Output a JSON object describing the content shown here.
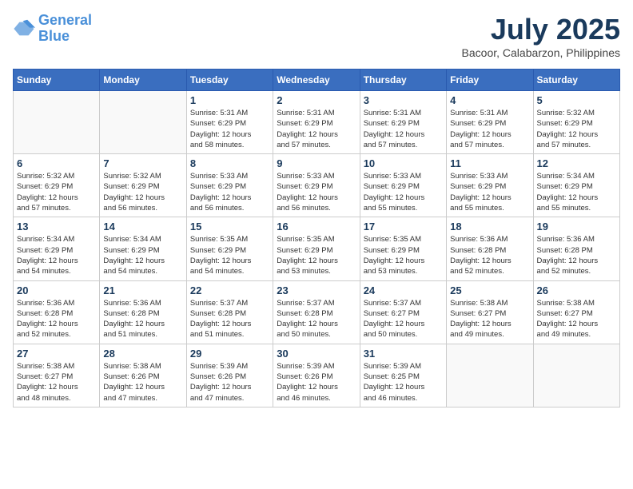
{
  "logo": {
    "line1": "General",
    "line2": "Blue"
  },
  "title": "July 2025",
  "location": "Bacoor, Calabarzon, Philippines",
  "weekdays": [
    "Sunday",
    "Monday",
    "Tuesday",
    "Wednesday",
    "Thursday",
    "Friday",
    "Saturday"
  ],
  "weeks": [
    [
      {
        "day": "",
        "info": ""
      },
      {
        "day": "",
        "info": ""
      },
      {
        "day": "1",
        "info": "Sunrise: 5:31 AM\nSunset: 6:29 PM\nDaylight: 12 hours\nand 58 minutes."
      },
      {
        "day": "2",
        "info": "Sunrise: 5:31 AM\nSunset: 6:29 PM\nDaylight: 12 hours\nand 57 minutes."
      },
      {
        "day": "3",
        "info": "Sunrise: 5:31 AM\nSunset: 6:29 PM\nDaylight: 12 hours\nand 57 minutes."
      },
      {
        "day": "4",
        "info": "Sunrise: 5:31 AM\nSunset: 6:29 PM\nDaylight: 12 hours\nand 57 minutes."
      },
      {
        "day": "5",
        "info": "Sunrise: 5:32 AM\nSunset: 6:29 PM\nDaylight: 12 hours\nand 57 minutes."
      }
    ],
    [
      {
        "day": "6",
        "info": "Sunrise: 5:32 AM\nSunset: 6:29 PM\nDaylight: 12 hours\nand 57 minutes."
      },
      {
        "day": "7",
        "info": "Sunrise: 5:32 AM\nSunset: 6:29 PM\nDaylight: 12 hours\nand 56 minutes."
      },
      {
        "day": "8",
        "info": "Sunrise: 5:33 AM\nSunset: 6:29 PM\nDaylight: 12 hours\nand 56 minutes."
      },
      {
        "day": "9",
        "info": "Sunrise: 5:33 AM\nSunset: 6:29 PM\nDaylight: 12 hours\nand 56 minutes."
      },
      {
        "day": "10",
        "info": "Sunrise: 5:33 AM\nSunset: 6:29 PM\nDaylight: 12 hours\nand 55 minutes."
      },
      {
        "day": "11",
        "info": "Sunrise: 5:33 AM\nSunset: 6:29 PM\nDaylight: 12 hours\nand 55 minutes."
      },
      {
        "day": "12",
        "info": "Sunrise: 5:34 AM\nSunset: 6:29 PM\nDaylight: 12 hours\nand 55 minutes."
      }
    ],
    [
      {
        "day": "13",
        "info": "Sunrise: 5:34 AM\nSunset: 6:29 PM\nDaylight: 12 hours\nand 54 minutes."
      },
      {
        "day": "14",
        "info": "Sunrise: 5:34 AM\nSunset: 6:29 PM\nDaylight: 12 hours\nand 54 minutes."
      },
      {
        "day": "15",
        "info": "Sunrise: 5:35 AM\nSunset: 6:29 PM\nDaylight: 12 hours\nand 54 minutes."
      },
      {
        "day": "16",
        "info": "Sunrise: 5:35 AM\nSunset: 6:29 PM\nDaylight: 12 hours\nand 53 minutes."
      },
      {
        "day": "17",
        "info": "Sunrise: 5:35 AM\nSunset: 6:29 PM\nDaylight: 12 hours\nand 53 minutes."
      },
      {
        "day": "18",
        "info": "Sunrise: 5:36 AM\nSunset: 6:28 PM\nDaylight: 12 hours\nand 52 minutes."
      },
      {
        "day": "19",
        "info": "Sunrise: 5:36 AM\nSunset: 6:28 PM\nDaylight: 12 hours\nand 52 minutes."
      }
    ],
    [
      {
        "day": "20",
        "info": "Sunrise: 5:36 AM\nSunset: 6:28 PM\nDaylight: 12 hours\nand 52 minutes."
      },
      {
        "day": "21",
        "info": "Sunrise: 5:36 AM\nSunset: 6:28 PM\nDaylight: 12 hours\nand 51 minutes."
      },
      {
        "day": "22",
        "info": "Sunrise: 5:37 AM\nSunset: 6:28 PM\nDaylight: 12 hours\nand 51 minutes."
      },
      {
        "day": "23",
        "info": "Sunrise: 5:37 AM\nSunset: 6:28 PM\nDaylight: 12 hours\nand 50 minutes."
      },
      {
        "day": "24",
        "info": "Sunrise: 5:37 AM\nSunset: 6:27 PM\nDaylight: 12 hours\nand 50 minutes."
      },
      {
        "day": "25",
        "info": "Sunrise: 5:38 AM\nSunset: 6:27 PM\nDaylight: 12 hours\nand 49 minutes."
      },
      {
        "day": "26",
        "info": "Sunrise: 5:38 AM\nSunset: 6:27 PM\nDaylight: 12 hours\nand 49 minutes."
      }
    ],
    [
      {
        "day": "27",
        "info": "Sunrise: 5:38 AM\nSunset: 6:27 PM\nDaylight: 12 hours\nand 48 minutes."
      },
      {
        "day": "28",
        "info": "Sunrise: 5:38 AM\nSunset: 6:26 PM\nDaylight: 12 hours\nand 47 minutes."
      },
      {
        "day": "29",
        "info": "Sunrise: 5:39 AM\nSunset: 6:26 PM\nDaylight: 12 hours\nand 47 minutes."
      },
      {
        "day": "30",
        "info": "Sunrise: 5:39 AM\nSunset: 6:26 PM\nDaylight: 12 hours\nand 46 minutes."
      },
      {
        "day": "31",
        "info": "Sunrise: 5:39 AM\nSunset: 6:25 PM\nDaylight: 12 hours\nand 46 minutes."
      },
      {
        "day": "",
        "info": ""
      },
      {
        "day": "",
        "info": ""
      }
    ]
  ]
}
